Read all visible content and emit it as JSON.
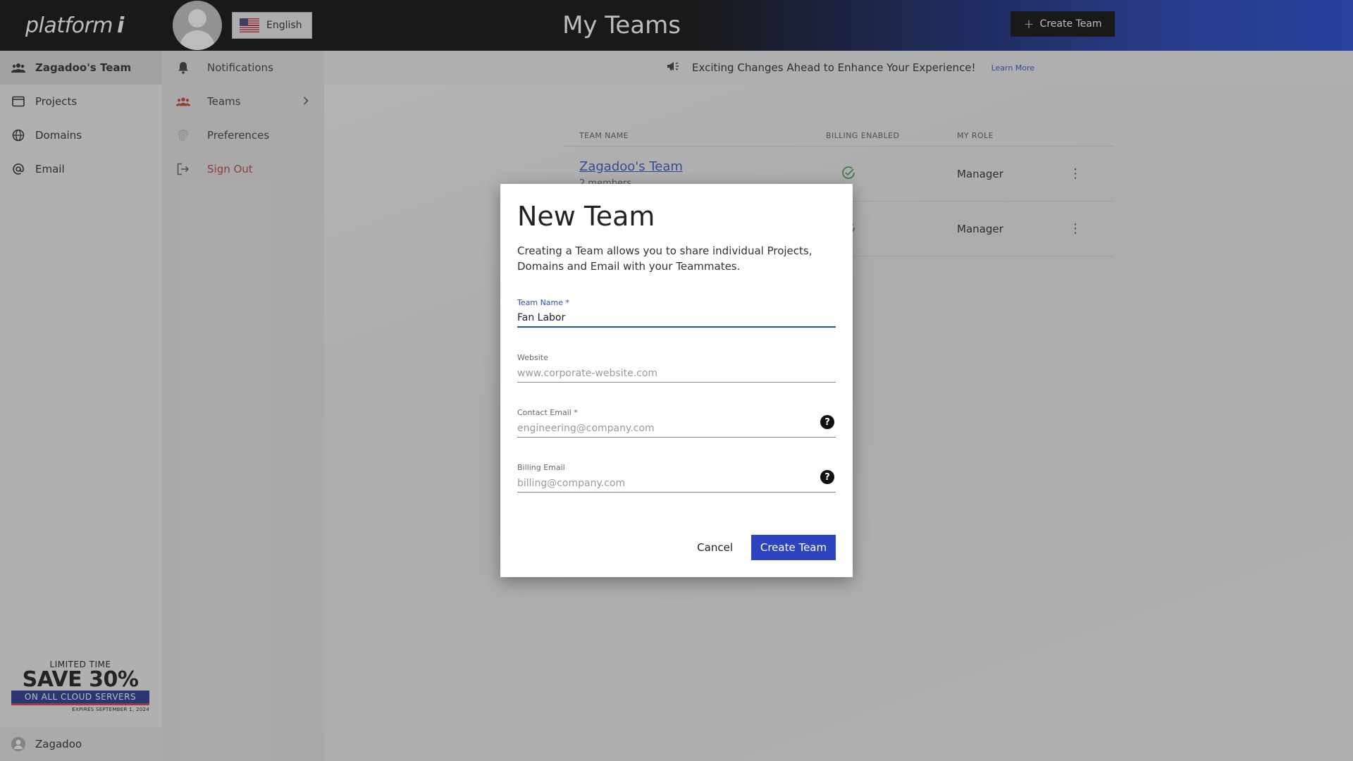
{
  "brand": {
    "logo_text": "platform",
    "logo_mark": "i"
  },
  "leftnav": {
    "items": [
      {
        "label": "Zagadoo's Team",
        "icon": "team-icon",
        "active": true
      },
      {
        "label": "Projects",
        "icon": "browser-window-icon"
      },
      {
        "label": "Domains",
        "icon": "globe-icon"
      },
      {
        "label": "Email",
        "icon": "at-icon"
      }
    ],
    "promo": {
      "line1": "LIMITED TIME",
      "line2": "SAVE 30%",
      "line3": "ON ALL CLOUD SERVERS",
      "line4": "EXPIRES SEPTEMBER 1, 2024"
    },
    "user": "Zagadoo"
  },
  "usermenu": {
    "language": "English",
    "items": [
      {
        "label": "Notifications",
        "icon": "bell-icon"
      },
      {
        "label": "Teams",
        "icon": "team-icon"
      },
      {
        "label": "Preferences",
        "icon": "fingerprint-icon"
      },
      {
        "label": "Sign Out",
        "icon": "sign-out-icon"
      }
    ]
  },
  "header": {
    "title": "My Teams",
    "create_button": "Create Team"
  },
  "banner": {
    "message": "Exciting Changes Ahead to Enhance Your Experience!",
    "link": "Learn More"
  },
  "table": {
    "headers": [
      "TEAM NAME",
      "BILLING ENABLED",
      "MY ROLE"
    ],
    "rows": [
      {
        "name": "Zagadoo's Team",
        "members": "2 members",
        "role": "Manager"
      },
      {
        "name": "",
        "members": "",
        "role": "Manager"
      }
    ]
  },
  "dialog": {
    "title": "New Team",
    "description": "Creating a Team allows you to share individual Projects, Domains and Email with your Teammates.",
    "fields": {
      "team_name": {
        "label": "Team Name *",
        "value": "Fan Labor"
      },
      "website": {
        "label": "Website",
        "placeholder": "www.corporate-website.com"
      },
      "contact_email": {
        "label": "Contact Email *",
        "placeholder": "engineering@company.com"
      },
      "billing_email": {
        "label": "Billing Email",
        "placeholder": "billing@company.com"
      }
    },
    "help_glyph": "?",
    "cancel": "Cancel",
    "submit": "Create Team"
  },
  "colors": {
    "accent": "#2d44c0",
    "link": "#2d4fb8",
    "signout": "#b53a3a",
    "check": "#3a9a4a"
  }
}
